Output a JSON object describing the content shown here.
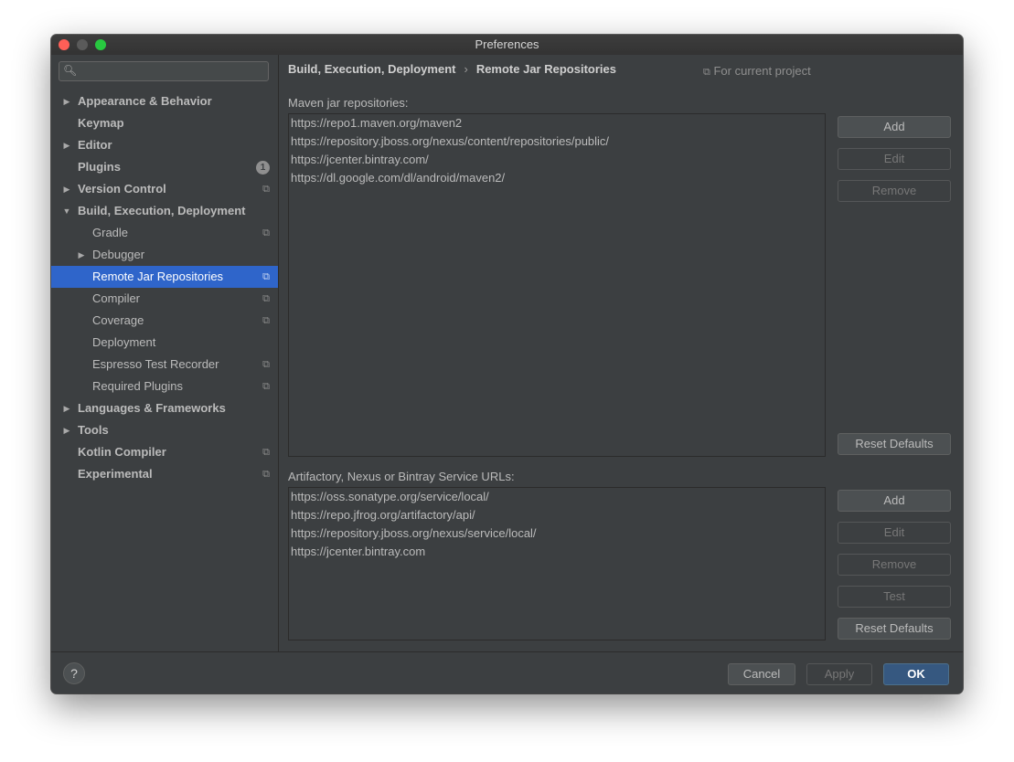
{
  "window": {
    "title": "Preferences"
  },
  "sidebar": {
    "search_placeholder": "",
    "items": [
      {
        "label": "Appearance & Behavior",
        "level": 0,
        "arrow": "right",
        "bold": true,
        "project": false
      },
      {
        "label": "Keymap",
        "level": 0,
        "arrow": "",
        "bold": true,
        "project": false
      },
      {
        "label": "Editor",
        "level": 0,
        "arrow": "right",
        "bold": true,
        "project": false
      },
      {
        "label": "Plugins",
        "level": 0,
        "arrow": "",
        "bold": true,
        "project": false,
        "badge": "1"
      },
      {
        "label": "Version Control",
        "level": 0,
        "arrow": "right",
        "bold": true,
        "project": true
      },
      {
        "label": "Build, Execution, Deployment",
        "level": 0,
        "arrow": "down",
        "bold": true,
        "project": false
      },
      {
        "label": "Gradle",
        "level": 1,
        "arrow": "",
        "bold": false,
        "project": true
      },
      {
        "label": "Debugger",
        "level": 1,
        "arrow": "right",
        "bold": false,
        "project": false
      },
      {
        "label": "Remote Jar Repositories",
        "level": 1,
        "arrow": "",
        "bold": false,
        "project": true,
        "selected": true
      },
      {
        "label": "Compiler",
        "level": 1,
        "arrow": "",
        "bold": false,
        "project": true
      },
      {
        "label": "Coverage",
        "level": 1,
        "arrow": "",
        "bold": false,
        "project": true
      },
      {
        "label": "Deployment",
        "level": 1,
        "arrow": "",
        "bold": false,
        "project": false
      },
      {
        "label": "Espresso Test Recorder",
        "level": 1,
        "arrow": "",
        "bold": false,
        "project": true
      },
      {
        "label": "Required Plugins",
        "level": 1,
        "arrow": "",
        "bold": false,
        "project": true
      },
      {
        "label": "Languages & Frameworks",
        "level": 0,
        "arrow": "right",
        "bold": true,
        "project": false
      },
      {
        "label": "Tools",
        "level": 0,
        "arrow": "right",
        "bold": true,
        "project": false
      },
      {
        "label": "Kotlin Compiler",
        "level": 0,
        "arrow": "",
        "bold": true,
        "project": true
      },
      {
        "label": "Experimental",
        "level": 0,
        "arrow": "",
        "bold": true,
        "project": true
      }
    ]
  },
  "header": {
    "breadcrumb": [
      "Build, Execution, Deployment",
      "Remote Jar Repositories"
    ],
    "for_current_project": "For current project"
  },
  "maven": {
    "label": "Maven jar repositories:",
    "urls": [
      "https://repo1.maven.org/maven2",
      "https://repository.jboss.org/nexus/content/repositories/public/",
      "https://jcenter.bintray.com/",
      "https://dl.google.com/dl/android/maven2/"
    ],
    "buttons": {
      "add": "Add",
      "edit": "Edit",
      "remove": "Remove",
      "reset": "Reset Defaults"
    }
  },
  "services": {
    "label": "Artifactory, Nexus or Bintray Service URLs:",
    "urls": [
      "https://oss.sonatype.org/service/local/",
      "https://repo.jfrog.org/artifactory/api/",
      "https://repository.jboss.org/nexus/service/local/",
      "https://jcenter.bintray.com"
    ],
    "buttons": {
      "add": "Add",
      "edit": "Edit",
      "remove": "Remove",
      "test": "Test",
      "reset": "Reset Defaults"
    }
  },
  "footer": {
    "help": "?",
    "cancel": "Cancel",
    "apply": "Apply",
    "ok": "OK"
  },
  "icons": {
    "search": "magnifier-icon",
    "project_scope": "copy-icon",
    "expand": "triangle-right-icon",
    "collapse": "triangle-down-icon"
  },
  "colors": {
    "background": "#3c3f41",
    "selection": "#2f65ca",
    "ok_button": "#365880",
    "text": "#bbbbbb"
  }
}
